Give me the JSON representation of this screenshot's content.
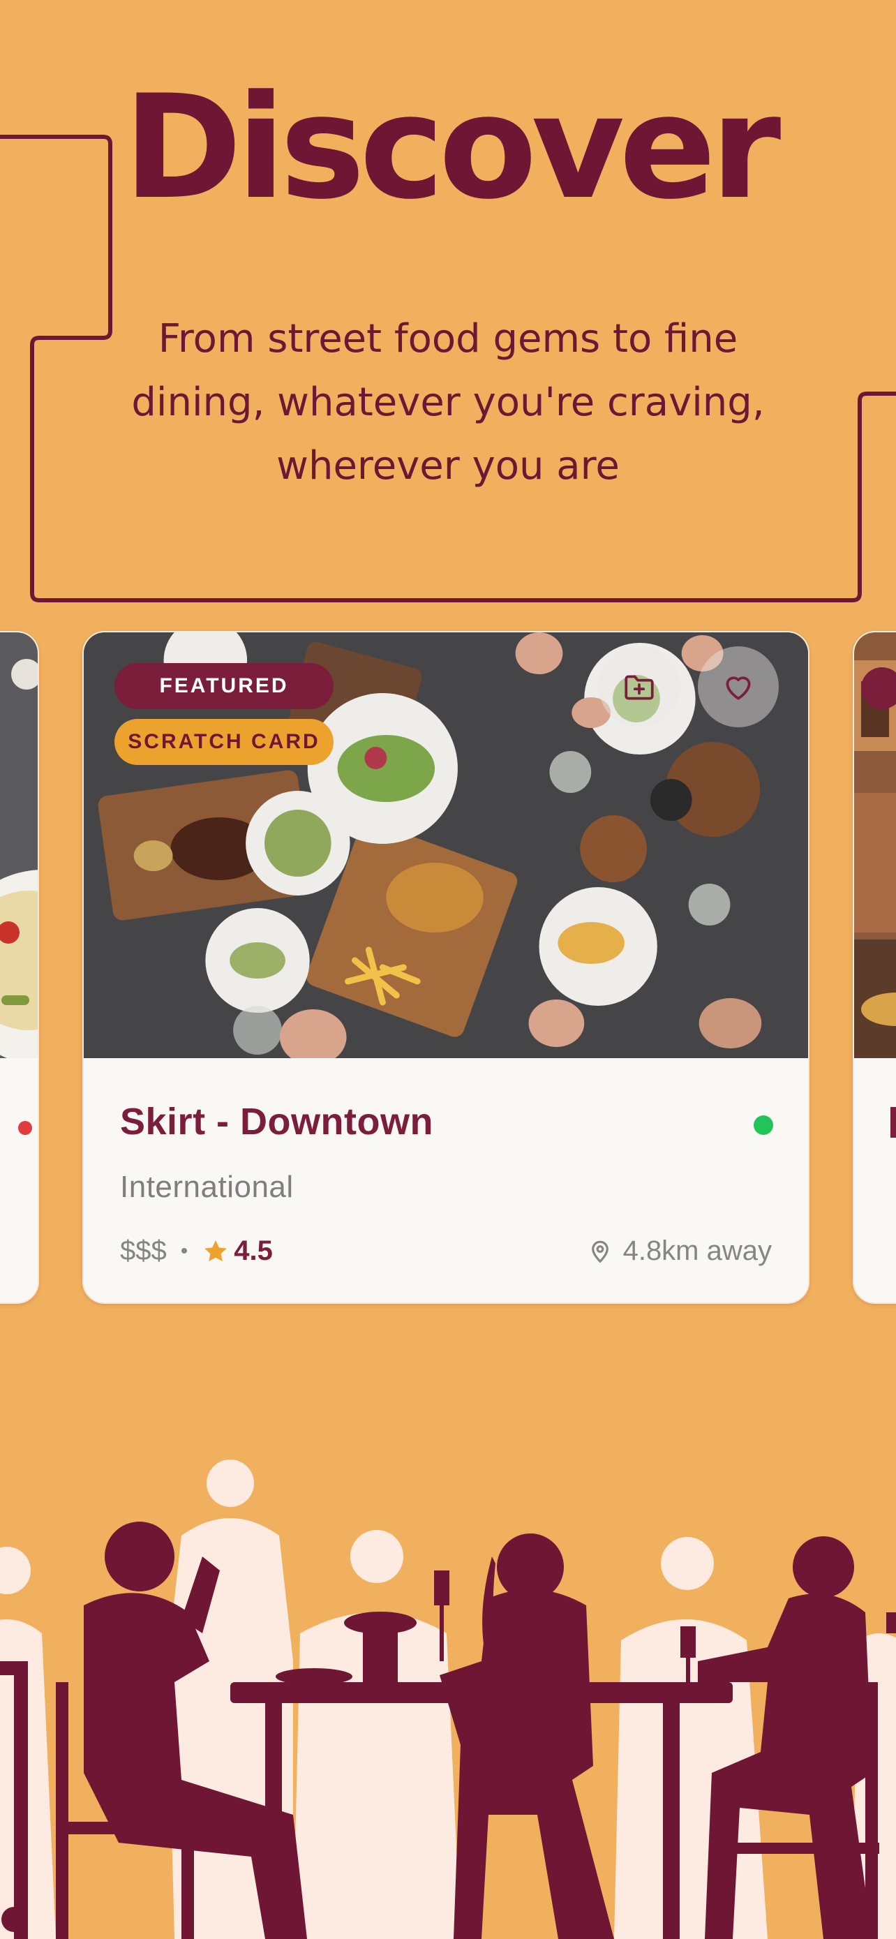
{
  "header": {
    "title": "Discover",
    "subtitle": "From street food gems to fine dining, whatever you're craving, wherever you are"
  },
  "cards": {
    "main": {
      "badges": {
        "featured": "FEATURED",
        "scratch": "SCRATCH CARD"
      },
      "name": "Skirt - Downtown",
      "cuisine": "International",
      "price": "$$$",
      "separator": "•",
      "rating": "4.5",
      "distance": "4.8km away",
      "open_status_color": "#22C45A"
    }
  },
  "icons": {
    "save_folder": "folder-plus-icon",
    "favorite": "heart-icon",
    "rating": "star-icon",
    "location": "map-pin-icon"
  },
  "colors": {
    "background": "#F1B05E",
    "brand": "#6E1634",
    "badge_featured": "#7A1E3C",
    "badge_scratch": "#EDA22E",
    "silhouette_dark": "#6E1634",
    "silhouette_light": "#FDEAE0"
  }
}
